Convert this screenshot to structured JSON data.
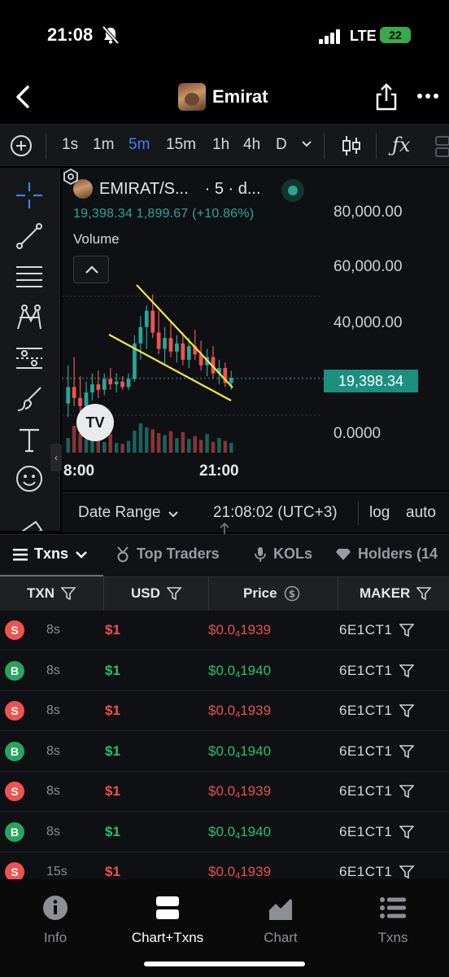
{
  "status_bar": {
    "time": "21:08",
    "network": "LTE",
    "battery": "22"
  },
  "header": {
    "title": "Emirat"
  },
  "toolbar": {
    "timeframes": [
      "1s",
      "1m",
      "5m",
      "15m",
      "1h",
      "4h",
      "D"
    ],
    "active_timeframe": "5m",
    "fx_label": "ƒx"
  },
  "chart": {
    "symbol": "EMIRAT/S...",
    "interval_info": "· 5 · d...",
    "price_line": "19,398.34  1,899.67 (+10.86%)",
    "volume_label": "Volume",
    "y_labels": [
      "80,000.00",
      "60,000.00",
      "40,000.00",
      "0.0000"
    ],
    "last_price_tag": "19,398.34",
    "x_labels": [
      "8:00",
      "21:00"
    ],
    "logo_text": "TV",
    "accent_up": "#26a69a",
    "accent_down": "#ef5350",
    "trendline_color": "#f5e642"
  },
  "chart_data": {
    "type": "candlestick",
    "title": "EMIRAT/S...",
    "xlabel": "",
    "ylabel": "",
    "x_ticks": [
      "8:00",
      "21:00"
    ],
    "y_ticks": [
      0,
      40000,
      60000,
      80000
    ],
    "last_price": 19398.34,
    "change": 1899.67,
    "change_pct": 10.86,
    "candles": [
      {
        "o": 10000,
        "h": 24000,
        "l": 5000,
        "c": 16000
      },
      {
        "o": 16000,
        "h": 27000,
        "l": 9000,
        "c": 12000
      },
      {
        "o": 12000,
        "h": 20000,
        "l": 4000,
        "c": 9000
      },
      {
        "o": 9000,
        "h": 18000,
        "l": 5000,
        "c": 14000
      },
      {
        "o": 14000,
        "h": 21000,
        "l": 11000,
        "c": 17000
      },
      {
        "o": 17000,
        "h": 22000,
        "l": 12000,
        "c": 15000
      },
      {
        "o": 15000,
        "h": 21000,
        "l": 13000,
        "c": 19000
      },
      {
        "o": 19000,
        "h": 23000,
        "l": 15000,
        "c": 17000
      },
      {
        "o": 17000,
        "h": 21000,
        "l": 14000,
        "c": 18000
      },
      {
        "o": 18000,
        "h": 20000,
        "l": 15000,
        "c": 16000
      },
      {
        "o": 16000,
        "h": 21000,
        "l": 15000,
        "c": 19000
      },
      {
        "o": 19000,
        "h": 35000,
        "l": 18000,
        "c": 32000
      },
      {
        "o": 32000,
        "h": 42000,
        "l": 26000,
        "c": 38000
      },
      {
        "o": 38000,
        "h": 46000,
        "l": 30000,
        "c": 44000
      },
      {
        "o": 44000,
        "h": 50000,
        "l": 34000,
        "c": 36000
      },
      {
        "o": 36000,
        "h": 44000,
        "l": 28000,
        "c": 30000
      },
      {
        "o": 30000,
        "h": 38000,
        "l": 24000,
        "c": 34000
      },
      {
        "o": 34000,
        "h": 40000,
        "l": 27000,
        "c": 29000
      },
      {
        "o": 29000,
        "h": 35000,
        "l": 25000,
        "c": 32000
      },
      {
        "o": 32000,
        "h": 36000,
        "l": 24000,
        "c": 26000
      },
      {
        "o": 26000,
        "h": 34000,
        "l": 23000,
        "c": 31000
      },
      {
        "o": 31000,
        "h": 37000,
        "l": 26000,
        "c": 28000
      },
      {
        "o": 28000,
        "h": 33000,
        "l": 22000,
        "c": 24000
      },
      {
        "o": 24000,
        "h": 30000,
        "l": 20000,
        "c": 27000
      },
      {
        "o": 27000,
        "h": 31000,
        "l": 19000,
        "c": 21000
      },
      {
        "o": 21000,
        "h": 26000,
        "l": 17000,
        "c": 23000
      },
      {
        "o": 23000,
        "h": 25000,
        "l": 16000,
        "c": 17500
      },
      {
        "o": 17500,
        "h": 22000,
        "l": 15000,
        "c": 19398
      }
    ],
    "volume": [
      30,
      55,
      40,
      28,
      35,
      25,
      22,
      38,
      20,
      18,
      24,
      45,
      60,
      52,
      48,
      40,
      36,
      44,
      30,
      42,
      28,
      34,
      26,
      38,
      22,
      30,
      24,
      20
    ]
  },
  "range_bar": {
    "date_range": "Date Range",
    "timestamp": "21:08:02 (UTC+3)",
    "log": "log",
    "auto": "auto"
  },
  "tabs": [
    {
      "label": "Txns",
      "active": true
    },
    {
      "label": "Top Traders",
      "active": false
    },
    {
      "label": "KOLs",
      "active": false
    },
    {
      "label": "Holders (14",
      "active": false
    }
  ],
  "table": {
    "headers": [
      "TXN",
      "USD",
      "Price",
      "MAKER"
    ],
    "rows": [
      {
        "side": "S",
        "age": "8s",
        "usd": "$1",
        "price_pre": "$0.0",
        "price_sub": "4",
        "price_post": "1939",
        "maker": "6E1CT1"
      },
      {
        "side": "B",
        "age": "8s",
        "usd": "$1",
        "price_pre": "$0.0",
        "price_sub": "4",
        "price_post": "1940",
        "maker": "6E1CT1"
      },
      {
        "side": "S",
        "age": "8s",
        "usd": "$1",
        "price_pre": "$0.0",
        "price_sub": "4",
        "price_post": "1939",
        "maker": "6E1CT1"
      },
      {
        "side": "B",
        "age": "8s",
        "usd": "$1",
        "price_pre": "$0.0",
        "price_sub": "4",
        "price_post": "1940",
        "maker": "6E1CT1"
      },
      {
        "side": "S",
        "age": "8s",
        "usd": "$1",
        "price_pre": "$0.0",
        "price_sub": "4",
        "price_post": "1939",
        "maker": "6E1CT1"
      },
      {
        "side": "B",
        "age": "8s",
        "usd": "$1",
        "price_pre": "$0.0",
        "price_sub": "4",
        "price_post": "1940",
        "maker": "6E1CT1"
      },
      {
        "side": "S",
        "age": "15s",
        "usd": "$1",
        "price_pre": "$0.0",
        "price_sub": "4",
        "price_post": "1939",
        "maker": "6E1CT1"
      }
    ]
  },
  "bottom_nav": [
    {
      "label": "Info",
      "icon": "info-icon"
    },
    {
      "label": "Chart+Txns",
      "icon": "split-view-icon",
      "active": true
    },
    {
      "label": "Chart",
      "icon": "area-chart-icon"
    },
    {
      "label": "Txns",
      "icon": "list-icon"
    }
  ]
}
